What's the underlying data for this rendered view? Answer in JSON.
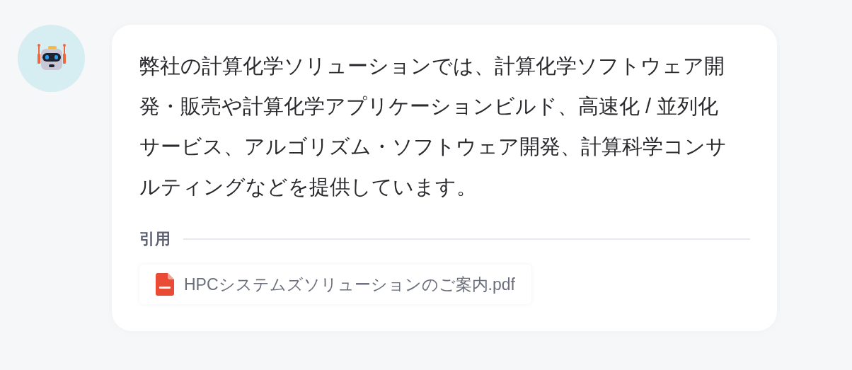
{
  "message": {
    "text": "弊社の計算化学ソリューションでは、計算化学ソフトウェア開発・販売や計算化学アプリケーションビルド、高速化 / 並列化サービス、アルゴリズム・ソフトウェア開発、計算科学コンサルティングなどを提供しています。",
    "citations_label": "引用",
    "citations": [
      {
        "kind": "pdf",
        "name": "HPCシステムズソリューションのご案内.pdf"
      }
    ]
  }
}
